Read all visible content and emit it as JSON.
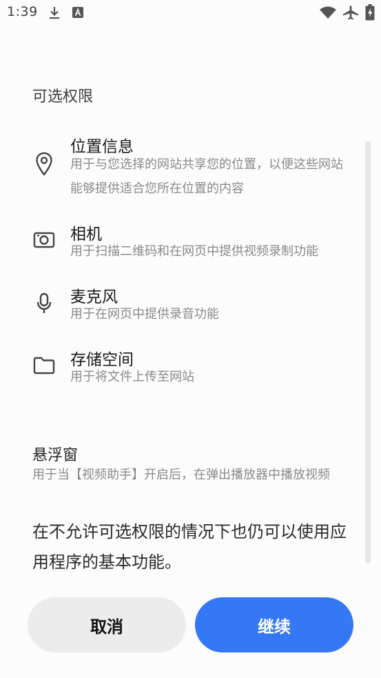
{
  "status_bar": {
    "time": "1:39",
    "icons": [
      "download-icon",
      "text-notification-icon",
      "wifi-icon",
      "airplane-mode-icon",
      "battery-charging-icon"
    ]
  },
  "dialog": {
    "section_title": "可选权限",
    "permissions": [
      {
        "icon": "location-pin-icon",
        "title": "位置信息",
        "description": "用于与您选择的网站共享您的位置，以便这些网站能够提供适合您所在位置的内容"
      },
      {
        "icon": "camera-icon",
        "title": "相机",
        "description": "用于扫描二维码和在网页中提供视频录制功能"
      },
      {
        "icon": "microphone-icon",
        "title": "麦克风",
        "description": "用于在网页中提供录音功能"
      },
      {
        "icon": "folder-icon",
        "title": "存储空间",
        "description": "用于将文件上传至网站"
      }
    ],
    "floating_window": {
      "title": "悬浮窗",
      "description": "用于当【视频助手】开启后，在弹出播放器中播放视频"
    },
    "notice": "在不允许可选权限的情况下也仍可以使用应用程序的基本功能。"
  },
  "buttons": {
    "cancel_label": "取消",
    "continue_label": "继续"
  },
  "colors": {
    "accent": "#3478f6",
    "cancel_bg": "#ececec",
    "secondary_text": "#8a8a8a"
  }
}
